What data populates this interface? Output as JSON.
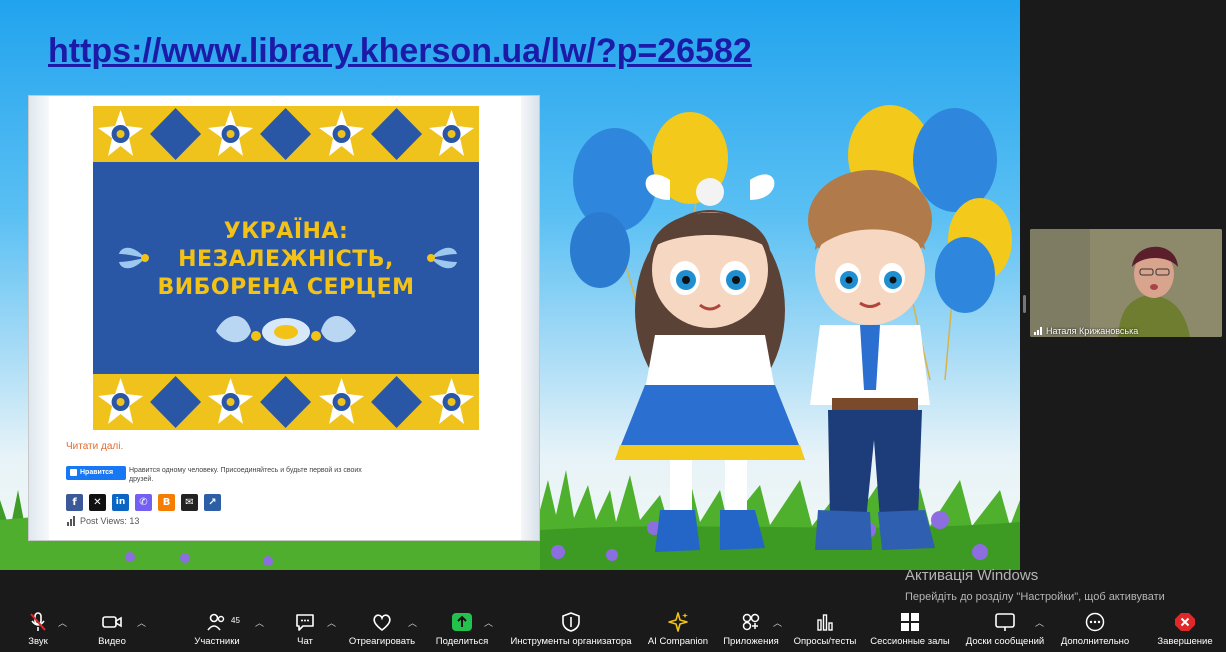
{
  "shared_screen": {
    "url_text": "https://www.library.kherson.ua/lw/?p=26582",
    "poster_title_lines": [
      "УКРАЇНА:",
      "НЕЗАЛЕЖНІСТЬ,",
      "ВИБОРЕНА СЕРЦЕМ"
    ],
    "read_more": "Читати далі.",
    "fb_like_label": "Нравится",
    "fb_like_text": "Нравится одному человеку. Присоединяйтесь и будьте первой из своих друзей.",
    "share_icons": [
      "facebook-icon",
      "x-icon",
      "linkedin-icon",
      "viber-icon",
      "blogger-icon",
      "email-icon",
      "share-icon"
    ],
    "post_views": "Post Views: 13"
  },
  "participant": {
    "name": "Наталя Крижановська"
  },
  "windows_activation": {
    "title": "Активація Windows",
    "text": "Перейдіть до розділу \"Настройки\", щоб активувати Windows."
  },
  "toolbar": {
    "audio": "Звук",
    "video": "Видео",
    "participants": "Участники",
    "participants_count": "45",
    "chat": "Чат",
    "react": "Отреагировать",
    "share": "Поделиться",
    "host_tools": "Инструменты организатора",
    "ai_companion": "AI Companion",
    "apps": "Приложения",
    "polls": "Опросы/тесты",
    "breakout": "Сессионные залы",
    "whiteboards": "Доски сообщений",
    "more": "Дополнительно",
    "end": "Завершение"
  },
  "colors": {
    "url": "#1b1ba8",
    "poster_blue": "#2a56a6",
    "poster_yellow": "#f3c217",
    "share_green": "#23c24c",
    "end_red": "#e02828"
  }
}
